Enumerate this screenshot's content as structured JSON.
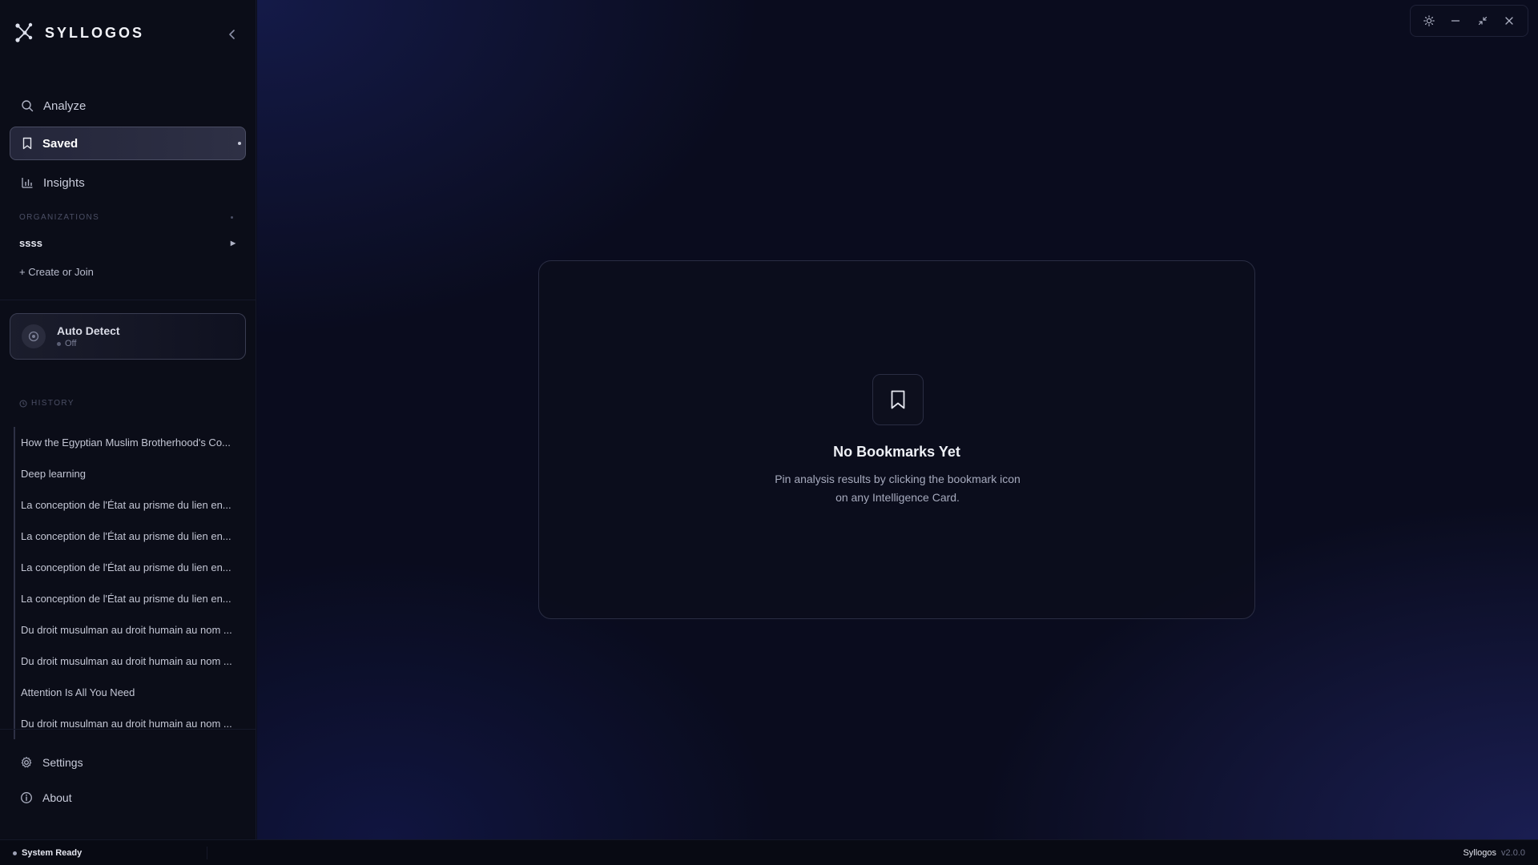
{
  "app": {
    "name": "SYLLOGOS"
  },
  "nav": {
    "analyze": "Analyze",
    "saved": "Saved",
    "insights": "Insights"
  },
  "organizations": {
    "label": "ORGANIZATIONS",
    "items": [
      {
        "name": "ssss"
      }
    ],
    "create_join": "+ Create or Join"
  },
  "auto_detect": {
    "title": "Auto Detect",
    "status": "Off"
  },
  "history": {
    "label": "HISTORY",
    "items": [
      "How the Egyptian Muslim Brotherhood's Co...",
      "Deep learning",
      "La conception de l'État au prisme du lien en...",
      "La conception de l'État au prisme du lien en...",
      "La conception de l'État au prisme du lien en...",
      "La conception de l'État au prisme du lien en...",
      "Du droit musulman au droit humain au nom ...",
      "Du droit musulman au droit humain au nom ...",
      "Attention Is All You Need",
      "Du droit musulman au droit humain au nom ..."
    ]
  },
  "bottom_nav": {
    "settings": "Settings",
    "about": "About"
  },
  "empty_state": {
    "title": "No Bookmarks Yet",
    "description": "Pin analysis results by clicking the bookmark icon on any Intelligence Card."
  },
  "statusbar": {
    "status": "System Ready",
    "app_name": "Syllogos",
    "version": "v2.0.0"
  },
  "icons": {
    "logo": "network-logo-icon",
    "collapse": "chevron-left-icon",
    "analyze": "search-icon",
    "saved": "bookmark-icon",
    "insights": "bar-chart-icon",
    "auto_detect": "target-icon",
    "history": "clock-icon",
    "settings": "gear-icon",
    "about": "info-icon",
    "theme": "sun-icon",
    "minimize": "minus-icon",
    "restore": "shrink-icon",
    "close": "close-icon"
  },
  "colors": {
    "background": "#0a0c1e",
    "sidebar": "#0b0d18",
    "active_item": "#2e3045",
    "text": "#e4e6ef"
  }
}
